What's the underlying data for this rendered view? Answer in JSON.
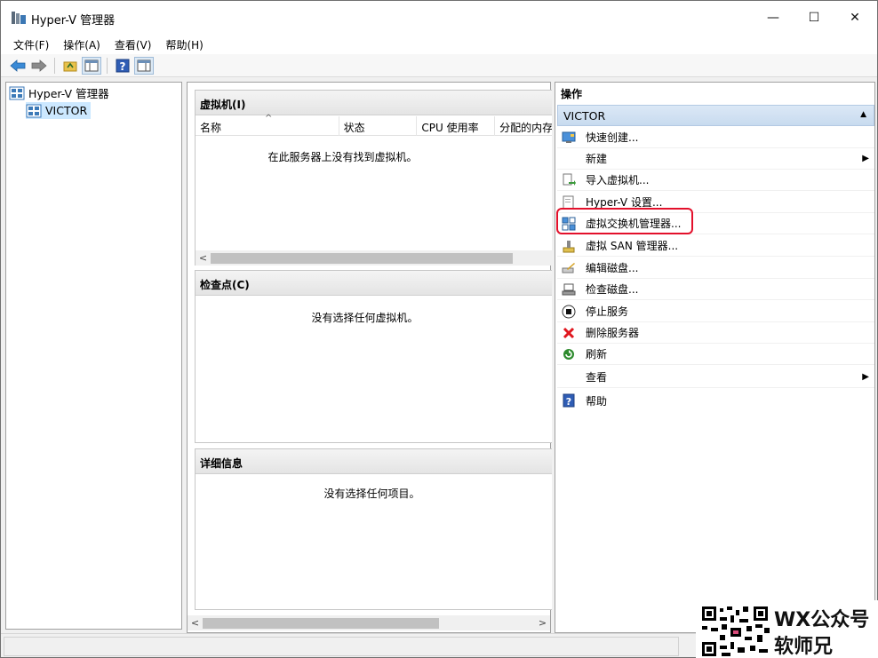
{
  "window": {
    "title": "Hyper-V 管理器",
    "controls": {
      "minimize": "—",
      "maximize": "☐",
      "close": "✕"
    }
  },
  "menubar": {
    "items": [
      {
        "label": "文件(F)"
      },
      {
        "label": "操作(A)"
      },
      {
        "label": "查看(V)"
      },
      {
        "label": "帮助(H)"
      }
    ]
  },
  "toolbar": {
    "icons": [
      "back-arrow-icon",
      "forward-arrow-icon",
      "up-folder-icon",
      "show-hide-tree-icon",
      "help-icon",
      "show-hide-action-pane-icon"
    ]
  },
  "tree": {
    "root": {
      "label": "Hyper-V 管理器",
      "icon": "hyperv-manager-icon"
    },
    "children": [
      {
        "label": "VICTOR",
        "icon": "server-icon",
        "selected": true
      }
    ]
  },
  "vm_section": {
    "title": "虚拟机(I)",
    "columns": [
      "名称",
      "状态",
      "CPU 使用率",
      "分配的内存"
    ],
    "empty_message": "在此服务器上没有找到虚拟机。"
  },
  "checkpoint_section": {
    "title": "检查点(C)",
    "empty_message": "没有选择任何虚拟机。"
  },
  "details_section": {
    "title": "详细信息",
    "empty_message": "没有选择任何项目。"
  },
  "actions": {
    "title": "操作",
    "group": "VICTOR",
    "items": [
      {
        "label": "快速创建...",
        "icon": "quick-create-icon"
      },
      {
        "label": "新建",
        "icon": "",
        "submenu": true
      },
      {
        "label": "导入虚拟机...",
        "icon": "import-vm-icon"
      },
      {
        "label": "Hyper-V 设置...",
        "icon": "settings-doc-icon"
      },
      {
        "label": "虚拟交换机管理器...",
        "icon": "virtual-switch-icon",
        "highlighted": true
      },
      {
        "label": "虚拟 SAN 管理器...",
        "icon": "san-icon"
      },
      {
        "label": "编辑磁盘...",
        "icon": "edit-disk-icon"
      },
      {
        "label": "检查磁盘...",
        "icon": "inspect-disk-icon"
      },
      {
        "label": "停止服务",
        "icon": "stop-service-icon"
      },
      {
        "label": "删除服务器",
        "icon": "delete-x-icon"
      },
      {
        "label": "刷新",
        "icon": "refresh-icon"
      },
      {
        "label": "查看",
        "icon": "",
        "submenu": true
      },
      {
        "label": "帮助",
        "icon": "help-icon"
      }
    ]
  },
  "watermark": {
    "line1": "WX公众号",
    "line2": "软师兄"
  },
  "colors": {
    "selection": "#cce8ff",
    "action_group": "#c8dbef",
    "highlight_border": "#e3102b",
    "delete_red": "#e0161e",
    "refresh_green": "#2e8b2e"
  }
}
